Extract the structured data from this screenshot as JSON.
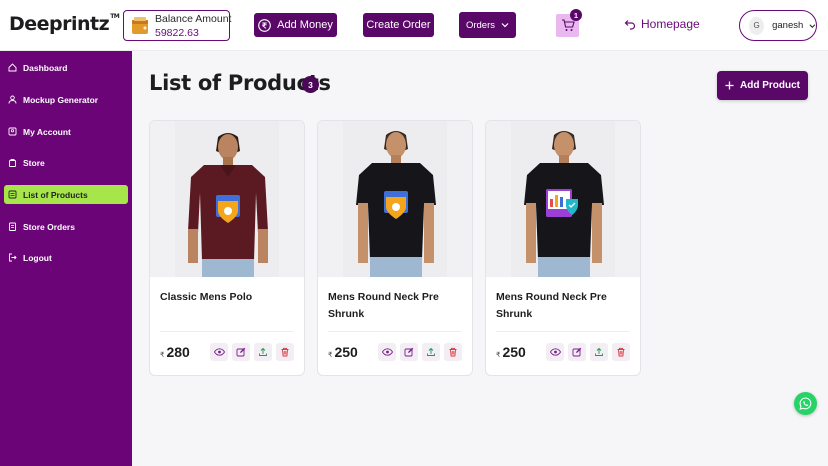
{
  "header": {
    "logo": "Deeprintz",
    "logo_tm": "TM",
    "balance_label": "Balance Amount",
    "balance_value": "59822.63",
    "add_money_label": "Add Money",
    "create_order_label": "Create Order",
    "orders_label": "Orders",
    "cart_count": "1",
    "homepage_label": "Homepage",
    "user_initial": "G",
    "user_name": "ganesh"
  },
  "sidebar": {
    "items": [
      {
        "label": "Dashboard",
        "icon": "home-icon"
      },
      {
        "label": "Mockup Generator",
        "icon": "user-icon"
      },
      {
        "label": "My Account",
        "icon": "account-icon"
      },
      {
        "label": "Store",
        "icon": "store-icon"
      },
      {
        "label": "List of Products",
        "icon": "list-icon",
        "active": true
      },
      {
        "label": "Store Orders",
        "icon": "orders-icon"
      },
      {
        "label": "Logout",
        "icon": "logout-icon"
      }
    ]
  },
  "main": {
    "title": "List of Products",
    "count": "3",
    "add_product_label": "Add Product"
  },
  "products": [
    {
      "name": "Classic Mens Polo",
      "currency": "₹",
      "price": "280",
      "shirt_color": "#5b1a22",
      "print": "shield"
    },
    {
      "name": "Mens Round Neck Pre Shrunk",
      "currency": "₹",
      "price": "250",
      "shirt_color": "#16161a",
      "print": "shield"
    },
    {
      "name": "Mens Round Neck Pre Shrunk",
      "currency": "₹",
      "price": "250",
      "shirt_color": "#16161a",
      "print": "chart"
    }
  ],
  "colors": {
    "brand": "#5a0868",
    "sidebar": "#6b0476",
    "active": "#a6e64a",
    "whatsapp": "#25d366"
  }
}
